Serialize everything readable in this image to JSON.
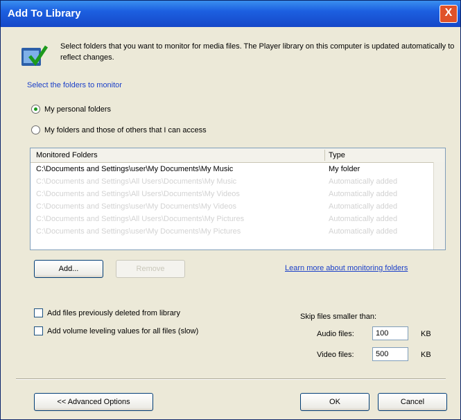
{
  "window": {
    "title": "Add To Library",
    "close_glyph": "X"
  },
  "info": {
    "icon": "library-folder-icon",
    "text": "Select folders that you want to monitor for media files. The Player library on this computer is updated automatically to reflect changes."
  },
  "select_label": "Select the folders to monitor",
  "options": {
    "my_folders": "My personal folders",
    "my_and_others": "My folders and those of others that I can access"
  },
  "list": {
    "headers": {
      "folder": "Monitored Folders",
      "type": "Type"
    },
    "rows": [
      {
        "path": "C:\\Documents and Settings\\user\\My Documents\\My Music",
        "type": "My folder"
      },
      {
        "path": "C:\\Documents and Settings\\All Users\\Documents\\My Music",
        "type": "Automatically added"
      },
      {
        "path": "C:\\Documents and Settings\\All Users\\Documents\\My Videos",
        "type": "Automatically added"
      },
      {
        "path": "C:\\Documents and Settings\\user\\My Documents\\My Videos",
        "type": "Automatically added"
      },
      {
        "path": "C:\\Documents and Settings\\All Users\\Documents\\My Pictures",
        "type": "Automatically added"
      },
      {
        "path": "C:\\Documents and Settings\\user\\My Documents\\My Pictures",
        "type": "Automatically added"
      }
    ]
  },
  "buttons": {
    "add": "Add...",
    "remove": "Remove",
    "advanced": "<< Advanced Options",
    "ok": "OK",
    "cancel": "Cancel"
  },
  "learn_link": "Learn more about monitoring folders",
  "checkboxes": {
    "add_deleted": "Add files previously deleted from library",
    "volume_leveling": "Add volume leveling values for all files (slow)"
  },
  "skip": {
    "label": "Skip files smaller than:",
    "audio_label": "Audio files:",
    "audio_value": "100",
    "video_label": "Video files:",
    "video_value": "500",
    "unit": "KB"
  }
}
